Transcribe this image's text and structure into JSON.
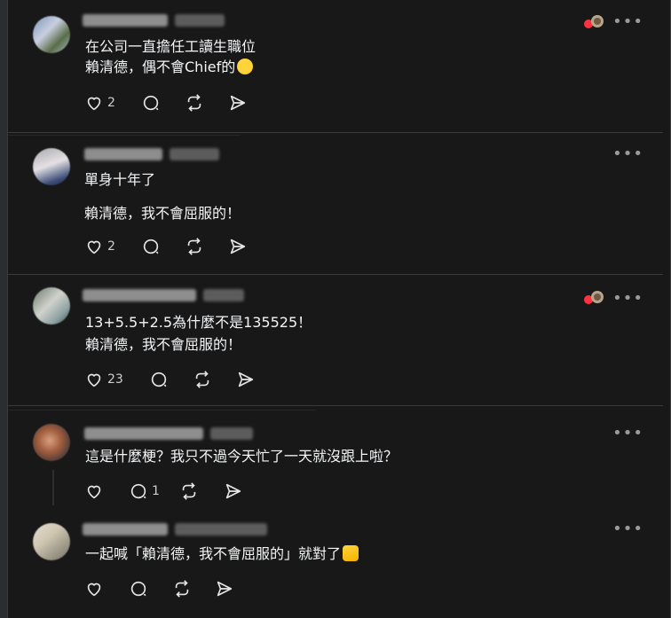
{
  "posts": [
    {
      "likes": "2",
      "replies": "",
      "lines": [
        "在公司一直擔任工讀生職位",
        "賴清德，偶不會Chief的"
      ],
      "emoji": "laughing-emoji"
    },
    {
      "likes": "2",
      "replies": "",
      "lines": [
        "單身十年了",
        "賴清德，我不會屈服的！"
      ]
    },
    {
      "likes": "23",
      "replies": "",
      "lines": [
        "13+5.5+2.5為什麼不是135525！",
        "賴清德，我不會屈服的！"
      ]
    },
    {
      "likes": "",
      "replies": "1",
      "lines": [
        "這是什麼梗？我只不過今天忙了一天就沒跟上啦？"
      ]
    },
    {
      "likes": "",
      "replies": "",
      "lines": [
        "一起喊「賴清德，我不會屈服的」就對了"
      ],
      "emoji": "thumbs-up-emoji"
    }
  ],
  "colors": {
    "background": "#181818",
    "text": "#f3f5f7",
    "muted": "#9a9a9a",
    "heart": "#ff3040"
  },
  "icons": [
    "heart-icon",
    "comment-icon",
    "repost-icon",
    "share-icon",
    "more-icon",
    "reaction-badge-icon"
  ]
}
